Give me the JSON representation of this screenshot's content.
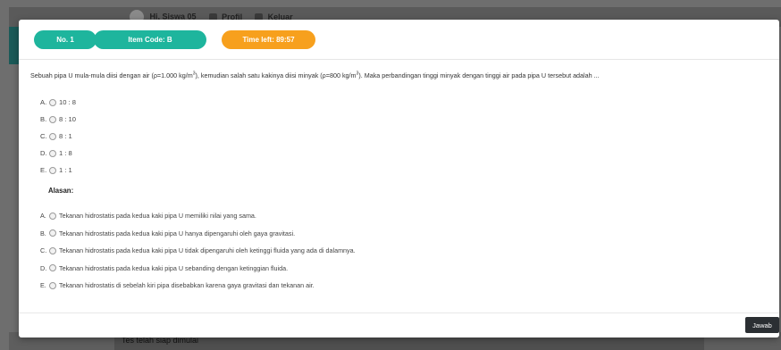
{
  "background": {
    "user_greeting": "Hi, Siswa 05",
    "profile_label": "Profil",
    "logout_label": "Keluar",
    "status_text": "Tes telah siap dimulai"
  },
  "header": {
    "number_label": "No. 1",
    "item_code_label": "Item Code: B",
    "time_left_label": "Time left: 89:57"
  },
  "question": {
    "text_part1": "Sebuah pipa U mula-mula diisi dengan air (ρ=1.000 kg/m",
    "sup1": "3",
    "text_part2": "), kemudian salah satu kakinya diisi minyak (ρ=800 kg/m",
    "sup2": "3",
    "text_part3": "). Maka perbandingan tinggi minyak dengan tinggi air pada pipa U tersebut adalah ..."
  },
  "options": [
    {
      "letter": "A.",
      "text": "10 : 8"
    },
    {
      "letter": "B.",
      "text": "8 : 10"
    },
    {
      "letter": "C.",
      "text": "8 : 1"
    },
    {
      "letter": "D.",
      "text": "1 : 8"
    },
    {
      "letter": "E.",
      "text": "1 : 1"
    }
  ],
  "reason_title": "Alasan:",
  "reasons": [
    {
      "letter": "A.",
      "text": "Tekanan hidrostatis pada kedua kaki pipa U memiliki nilai yang sama."
    },
    {
      "letter": "B.",
      "text": "Tekanan hidrostatis pada kedua kaki pipa U hanya dipengaruhi oleh gaya gravitasi."
    },
    {
      "letter": "C.",
      "text": "Tekanan hidrostatis pada kedua kaki pipa U tidak dipengaruhi oleh ketinggi fluida yang ada di dalamnya."
    },
    {
      "letter": "D.",
      "text": "Tekanan hidrostatis pada kedua kaki pipa U sebanding dengan ketinggian fluida."
    },
    {
      "letter": "E.",
      "text": "Tekanan hidrostatis di sebelah kiri pipa disebabkan karena gaya gravitasi dan tekanan air."
    }
  ],
  "footer": {
    "submit_label": "Jawab"
  },
  "colors": {
    "badge_teal": "#1eb59d",
    "badge_orange": "#f7a01d",
    "button_dark": "#2b2f33"
  }
}
